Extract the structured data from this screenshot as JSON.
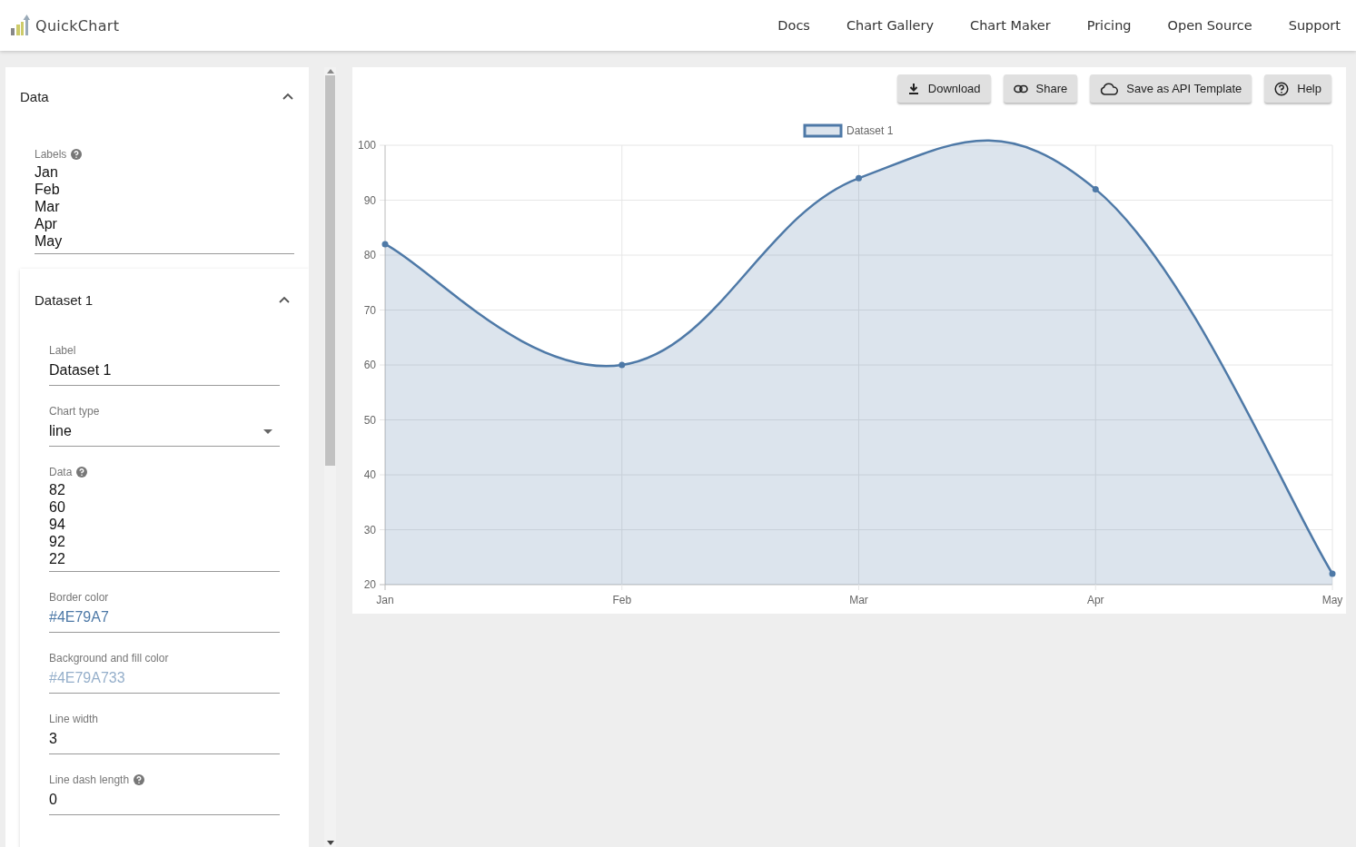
{
  "brand": "QuickChart",
  "nav": [
    "Docs",
    "Chart Gallery",
    "Chart Maker",
    "Pricing",
    "Open Source",
    "Support"
  ],
  "data_panel": {
    "title": "Data",
    "expanded": true,
    "labels_field": {
      "label": "Labels",
      "help": true,
      "lines": [
        "Jan",
        "Feb",
        "Mar",
        "Apr",
        "May"
      ]
    }
  },
  "dataset_panel": {
    "title": "Dataset 1",
    "expanded": true,
    "fields": [
      {
        "kind": "text",
        "label": "Label",
        "value": "Dataset 1",
        "help": false
      },
      {
        "kind": "select",
        "label": "Chart type",
        "value": "line",
        "help": false
      },
      {
        "kind": "lines",
        "label": "Data",
        "lines": [
          "82",
          "60",
          "94",
          "92",
          "22"
        ],
        "help": true
      },
      {
        "kind": "color",
        "label": "Border color",
        "value": "#4E79A7",
        "help": false
      },
      {
        "kind": "color",
        "label": "Background and fill color",
        "value": "#4E79A733",
        "help": false
      },
      {
        "kind": "text",
        "label": "Line width",
        "value": "3",
        "help": false
      },
      {
        "kind": "text",
        "label": "Line dash length",
        "value": "0",
        "help": true
      }
    ]
  },
  "toolbar": [
    {
      "kind": "download",
      "label": "Download"
    },
    {
      "kind": "share",
      "label": "Share"
    },
    {
      "kind": "cloud",
      "label": "Save as API Template"
    },
    {
      "kind": "help",
      "label": "Help"
    }
  ],
  "chart": {
    "chart_data": {
      "type": "area",
      "categories": [
        "Jan",
        "Feb",
        "Mar",
        "Apr",
        "May"
      ],
      "series": [
        {
          "name": "Dataset 1",
          "color": "#4e79a7",
          "values": [
            82,
            60,
            94,
            92,
            22
          ]
        }
      ],
      "ylim": [
        20,
        100
      ],
      "grid": true,
      "yticks": [
        20,
        30,
        40,
        50,
        60,
        70,
        80,
        90,
        100
      ]
    }
  }
}
